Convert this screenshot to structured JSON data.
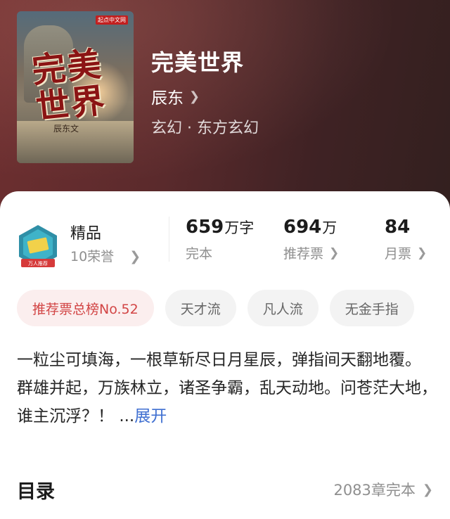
{
  "book": {
    "title": "完美世界",
    "author": "辰东",
    "genre": "玄幻 · 东方玄幻",
    "cover": {
      "title_art": "完美世界",
      "author_art": "辰东文",
      "publisher_badge": "起点中文网"
    }
  },
  "honor": {
    "label": "精品",
    "sub": "10荣誉",
    "badge_text": "万人推荐"
  },
  "stats": [
    {
      "value": "659",
      "unit": "万字",
      "label": "完本",
      "has_chevron": false
    },
    {
      "value": "694",
      "unit": "万",
      "label": "推荐票",
      "has_chevron": true
    },
    {
      "value": "84",
      "unit": "",
      "label": "月票",
      "has_chevron": true
    }
  ],
  "tags": [
    {
      "label": "推荐票总榜No.52",
      "type": "rank"
    },
    {
      "label": "天才流",
      "type": "normal"
    },
    {
      "label": "凡人流",
      "type": "normal"
    },
    {
      "label": "无金手指",
      "type": "normal"
    }
  ],
  "description": {
    "line1": "一粒尘可填海，一根草斩尽日月星辰，弹指间天翻地覆。",
    "line2": "群雄并起，万族林立，诸圣争霸，乱天动地。问苍茫大地，谁主沉浮？！ ",
    "ellipsis": "...",
    "expand_label": "展开"
  },
  "toc": {
    "label": "目录",
    "status": "2083章完本"
  },
  "icons": {
    "chevron": "chevron-right-icon",
    "honor": "shield-badge-icon"
  },
  "colors": {
    "hero_bg": "#5a2a2c",
    "rank_tag_text": "#d24545",
    "expand_link": "#3f6fd1"
  }
}
